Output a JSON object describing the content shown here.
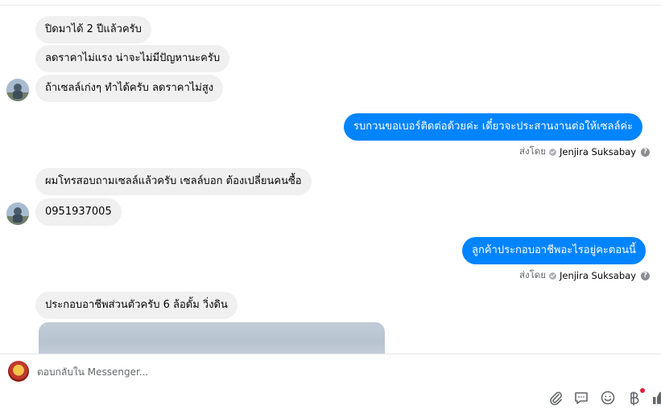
{
  "messages": [
    {
      "text": "ปิดมาได้ 2 ปีแล้วครับ"
    },
    {
      "text": "ลดราคาไม่แรง น่าจะไม่มีปัญหานะครับ"
    },
    {
      "text": "ถ้าเซลล์เก่งๆ ทำได้ครับ ลดราคาไม่สูง"
    },
    {
      "text": "รบกวนขอเบอร์ติดต่อด้วยค่ะ เดี๋ยวจะประสานงานต่อให้เซลล์ค่ะ"
    },
    {
      "text": "ผมโทรสอบถามเซลล์แล้วครับ เซลล์บอก ต้องเปลี่ยนคนซื้อ"
    },
    {
      "text": "0951937005"
    },
    {
      "text": "ลูกค้าประกอบอาชีพอะไรอยู่คะตอนนี้"
    },
    {
      "text": "ประกอบอาชีพส่วนตัวครับ 6 ล้อดั้ม วิ่งดิน"
    }
  ],
  "sent_by": {
    "prefix": "ส่งโดย",
    "sender": "Jenjira Suksabay"
  },
  "composer": {
    "placeholder": "ตอบกลับใน Messenger..."
  },
  "icons": [
    "paperclip-icon",
    "chat-bubble-icon",
    "emoji-icon",
    "baht-icon",
    "thumbs-up-icon",
    "info-icon",
    "check-icon"
  ],
  "colors": {
    "outgoing": "#0084ff",
    "incoming": "#f0f0f0",
    "notification_dot": "#e41e3f"
  }
}
